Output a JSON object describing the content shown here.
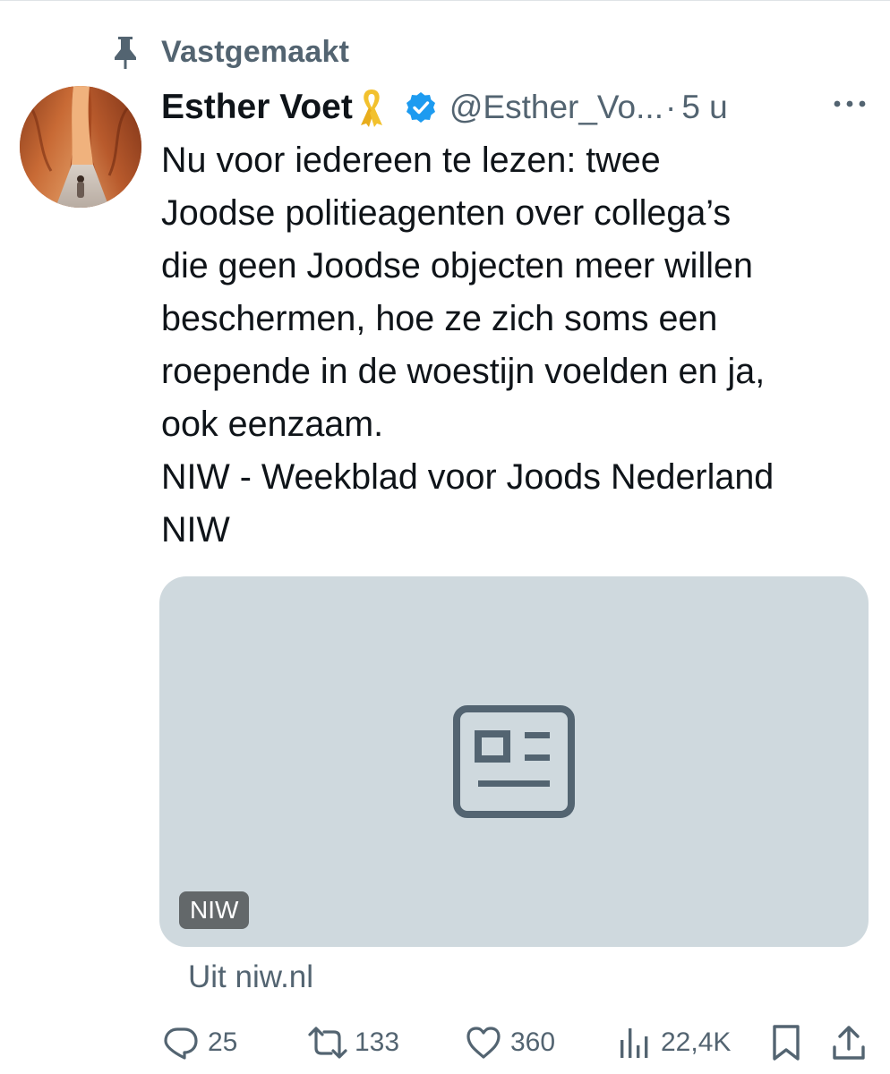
{
  "pinned": {
    "label": "Vastgemaakt",
    "icon": "pin-icon"
  },
  "author": {
    "display_name": "Esther Voet",
    "handle": "@Esther_Vo...",
    "separator": "·",
    "time_ago": "5 u",
    "badges": [
      "yellow-ribbon-icon",
      "verified-icon"
    ]
  },
  "tweet": {
    "lines": [
      "Nu voor iedereen te lezen: twee",
      "Joodse politieagenten over collega’s",
      "die geen Joodse objecten meer willen",
      "beschermen, hoe ze zich soms een",
      "roepende in de woestijn voelden en ja,",
      "ook eenzaam.",
      "NIW - Weekblad voor Joods Nederland",
      "NIW"
    ]
  },
  "card": {
    "domain_badge": "NIW",
    "source": "Uit niw.nl",
    "icon": "article-placeholder-icon"
  },
  "actions": {
    "replies": "25",
    "reposts": "133",
    "likes": "360",
    "views": "22,4K"
  },
  "colors": {
    "text": "#0f1419",
    "secondary": "#536471",
    "verified": "#1d9bf0",
    "ribbon": "#f2c12e",
    "card_bg": "#cfd9de"
  }
}
